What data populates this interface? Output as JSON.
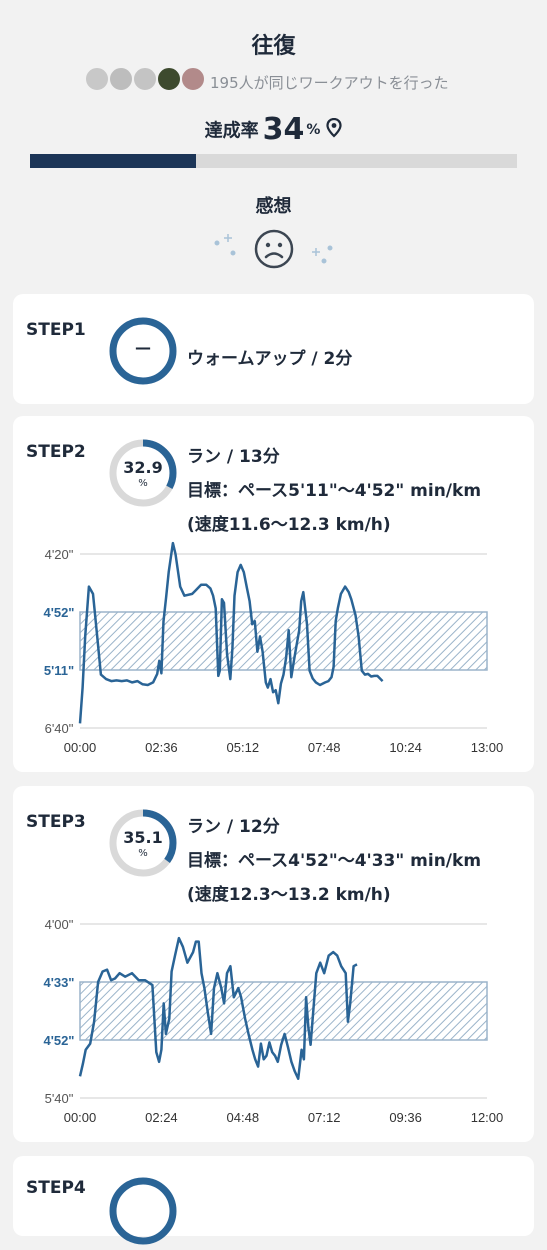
{
  "header": {
    "title": "往復",
    "participants_text": "195人が同じワークアウトを行った",
    "achievement_label": "達成率",
    "achievement_value": "34",
    "achievement_unit": "%",
    "achievement_fraction": 0.34,
    "impression_label": "感想",
    "impression_icon": "sad-face-icon"
  },
  "colors": {
    "accent": "#2a6496",
    "dark": "#1c3557",
    "track": "#d9d9d9"
  },
  "steps": [
    {
      "label": "STEP1",
      "ring_value": "—",
      "line1": "ウォームアップ / 2分"
    },
    {
      "label": "STEP2",
      "ring_value": "32.9",
      "ring_unit": "%",
      "ring_fraction": 0.329,
      "line1": "ラン / 13分",
      "line2": "目標：ペース5'11\"〜4'52\" min/km",
      "line3": "(速度11.6〜12.3 km/h)"
    },
    {
      "label": "STEP3",
      "ring_value": "35.1",
      "ring_unit": "%",
      "ring_fraction": 0.351,
      "line1": "ラン / 12分",
      "line2": "目標：ペース4'52\"〜4'33\" min/km",
      "line3": "(速度12.3〜13.2 km/h)"
    },
    {
      "label": "STEP4"
    }
  ],
  "chart_data": [
    {
      "type": "line",
      "y_ticks": [
        "4'20\"",
        "4'52\"",
        "5'11\"",
        "6'40\""
      ],
      "x_ticks": [
        "00:00",
        "02:36",
        "05:12",
        "07:48",
        "10:24",
        "13:00"
      ],
      "target_band": [
        "5'11\"",
        "4'52\""
      ],
      "xlim_sec": [
        0,
        780
      ],
      "series": [
        {
          "values_sec": [
            [
              0,
              393
            ],
            [
              5,
              338
            ],
            [
              10,
              300
            ],
            [
              17,
              278
            ],
            [
              25,
              282
            ],
            [
              33,
              300
            ],
            [
              40,
              318
            ],
            [
              50,
              325
            ],
            [
              60,
              328
            ],
            [
              70,
              327
            ],
            [
              80,
              328
            ],
            [
              90,
              327
            ],
            [
              100,
              330
            ],
            [
              110,
              328
            ],
            [
              120,
              333
            ],
            [
              130,
              334
            ],
            [
              140,
              330
            ],
            [
              148,
              317
            ],
            [
              152,
              308
            ],
            [
              156,
              316
            ],
            [
              160,
              295
            ],
            [
              165,
              284
            ],
            [
              170,
              270
            ],
            [
              178,
              254
            ],
            [
              183,
              260
            ],
            [
              192,
              278
            ],
            [
              200,
              283
            ],
            [
              215,
              282
            ],
            [
              222,
              280
            ],
            [
              232,
              277
            ],
            [
              242,
              277
            ],
            [
              250,
              279
            ],
            [
              255,
              283
            ],
            [
              260,
              290
            ],
            [
              265,
              320
            ],
            [
              268,
              312
            ],
            [
              272,
              285
            ],
            [
              276,
              287
            ],
            [
              282,
              306
            ],
            [
              288,
              325
            ],
            [
              292,
              304
            ],
            [
              296,
              283
            ],
            [
              302,
              270
            ],
            [
              308,
              266
            ],
            [
              314,
              270
            ],
            [
              320,
              279
            ],
            [
              325,
              286
            ],
            [
              330,
              296
            ],
            [
              335,
              295
            ],
            [
              340,
              305
            ],
            [
              345,
              300
            ],
            [
              350,
              305
            ],
            [
              356,
              330
            ],
            [
              360,
              338
            ],
            [
              365,
              325
            ],
            [
              370,
              345
            ],
            [
              375,
              342
            ],
            [
              380,
              362
            ],
            [
              385,
              332
            ],
            [
              390,
              318
            ],
            [
              395,
              307
            ],
            [
              400,
              298
            ],
            [
              405,
              322
            ],
            [
              410,
              308
            ],
            [
              415,
              303
            ],
            [
              420,
              298
            ],
            [
              424,
              286
            ],
            [
              428,
              281
            ],
            [
              435,
              296
            ],
            [
              440,
              312
            ],
            [
              446,
              324
            ],
            [
              452,
              330
            ],
            [
              460,
              334
            ],
            [
              470,
              330
            ],
            [
              476,
              328
            ],
            [
              482,
              322
            ],
            [
              486,
              310
            ],
            [
              490,
              295
            ],
            [
              494,
              290
            ],
            [
              500,
              282
            ],
            [
              508,
              278
            ],
            [
              515,
              281
            ],
            [
              520,
              285
            ],
            [
              528,
              293
            ],
            [
              534,
              300
            ],
            [
              540,
              312
            ],
            [
              546,
              318
            ],
            [
              552,
              317
            ],
            [
              558,
              321
            ],
            [
              564,
              320
            ],
            [
              570,
              320
            ],
            [
              580,
              328
            ]
          ]
        }
      ]
    },
    {
      "type": "line",
      "y_ticks": [
        "4'00\"",
        "4'33\"",
        "4'52\"",
        "5'40\""
      ],
      "x_ticks": [
        "00:00",
        "02:24",
        "04:48",
        "07:12",
        "09:36",
        "12:00"
      ],
      "target_band": [
        "4'52\"",
        "4'33\""
      ],
      "xlim_sec": [
        0,
        720
      ],
      "series": [
        {
          "values_sec": [
            [
              0,
              322
            ],
            [
              5,
              312
            ],
            [
              10,
              300
            ],
            [
              18,
              295
            ],
            [
              25,
              286
            ],
            [
              32,
              273
            ],
            [
              40,
              267
            ],
            [
              48,
              266
            ],
            [
              55,
              272
            ],
            [
              62,
              271
            ],
            [
              70,
              268
            ],
            [
              80,
              270
            ],
            [
              92,
              268
            ],
            [
              104,
              272
            ],
            [
              115,
              272
            ],
            [
              128,
              274
            ],
            [
              135,
              302
            ],
            [
              140,
              310
            ],
            [
              144,
              300
            ],
            [
              148,
              280
            ],
            [
              152,
              290
            ],
            [
              158,
              285
            ],
            [
              162,
              267
            ],
            [
              168,
              258
            ],
            [
              175,
              248
            ],
            [
              182,
              253
            ],
            [
              190,
              262
            ],
            [
              200,
              256
            ],
            [
              205,
              250
            ],
            [
              210,
              250
            ],
            [
              215,
              268
            ],
            [
              220,
              275
            ],
            [
              226,
              283
            ],
            [
              232,
              290
            ],
            [
              237,
              275
            ],
            [
              243,
              268
            ],
            [
              250,
              275
            ],
            [
              255,
              280
            ],
            [
              260,
              268
            ],
            [
              266,
              264
            ],
            [
              272,
              278
            ],
            [
              280,
              275
            ],
            [
              285,
              278
            ],
            [
              292,
              285
            ],
            [
              298,
              290
            ],
            [
              305,
              300
            ],
            [
              310,
              308
            ],
            [
              315,
              314
            ],
            [
              320,
              295
            ],
            [
              325,
              308
            ],
            [
              330,
              305
            ],
            [
              335,
              294
            ],
            [
              340,
              302
            ],
            [
              345,
              305
            ],
            [
              350,
              310
            ],
            [
              356,
              296
            ],
            [
              362,
              290
            ],
            [
              368,
              298
            ],
            [
              374,
              310
            ],
            [
              380,
              318
            ],
            [
              386,
              324
            ],
            [
              392,
              300
            ],
            [
              396,
              308
            ],
            [
              400,
              278
            ],
            [
              404,
              288
            ],
            [
              408,
              296
            ],
            [
              412,
              284
            ],
            [
              418,
              268
            ],
            [
              425,
              262
            ],
            [
              432,
              268
            ],
            [
              440,
              258
            ],
            [
              448,
              256
            ],
            [
              455,
              258
            ],
            [
              462,
              264
            ],
            [
              470,
              268
            ],
            [
              474,
              286
            ],
            [
              478,
              280
            ],
            [
              484,
              264
            ],
            [
              490,
              263
            ]
          ]
        }
      ]
    }
  ]
}
